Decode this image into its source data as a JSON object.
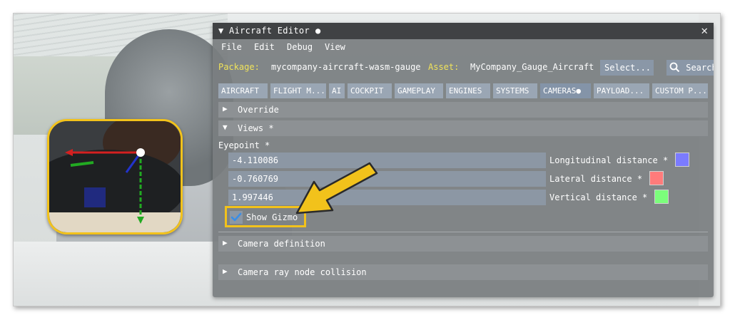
{
  "window": {
    "title": "▼ Aircraft Editor",
    "modified_dot": "●",
    "close_glyph": "✕"
  },
  "menu": [
    "File",
    "Edit",
    "Debug",
    "View"
  ],
  "package_row": {
    "package_label": "Package:",
    "package_value": "mycompany-aircraft-wasm-gauge",
    "asset_label": "Asset:",
    "asset_value": "MyCompany_Gauge_Aircraft",
    "select_button": "Select...",
    "search_button": "Search"
  },
  "tabs": [
    {
      "label": "AIRCRAFT"
    },
    {
      "label": "FLIGHT M..."
    },
    {
      "label": "AI"
    },
    {
      "label": "COCKPIT"
    },
    {
      "label": "GAMEPLAY"
    },
    {
      "label": "ENGINES"
    },
    {
      "label": "SYSTEMS"
    },
    {
      "label": "CAMERAS●",
      "active": true
    },
    {
      "label": "PAYLOAD..."
    },
    {
      "label": "CUSTOM P..."
    }
  ],
  "sections": {
    "override": {
      "arrow": "▶",
      "label": "Override"
    },
    "views": {
      "arrow": "▼",
      "label": "Views *"
    },
    "camera_definition": {
      "arrow": "▶",
      "label": "Camera definition"
    },
    "camera_ray": {
      "arrow": "▶",
      "label": "Camera ray node collision"
    }
  },
  "eyepoint": {
    "label": "Eyepoint *",
    "fields": [
      {
        "value": "-4.110086",
        "label": "Longitudinal distance *",
        "color": "#7b7bff"
      },
      {
        "value": "-0.760769",
        "label": "Lateral distance *",
        "color": "#ff7b7b"
      },
      {
        "value": "1.997446",
        "label": "Vertical distance *",
        "color": "#7bff7b"
      }
    ]
  },
  "show_gizmo": {
    "label": "Show Gizmo",
    "checked": true
  },
  "colors": {
    "highlight": "#f2c21b",
    "package_label": "#f0e35a",
    "gizmo_x": "#d42020",
    "gizmo_y": "#22aa22",
    "gizmo_z": "#2233cc"
  },
  "icons": {
    "search": "search-icon",
    "check": "checkmark-icon",
    "callout": "arrow-pointer-icon"
  }
}
